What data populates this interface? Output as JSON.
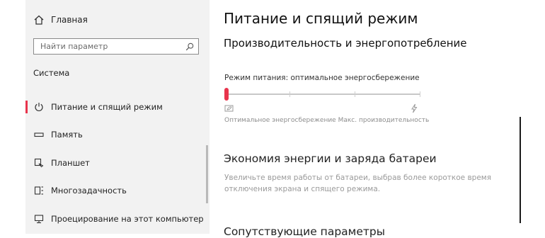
{
  "sidebar": {
    "home_label": "Главная",
    "search_placeholder": "Найти параметр",
    "section_title": "Система",
    "items": [
      {
        "label": "Питание и спящий режим",
        "icon": "power-icon",
        "active": true
      },
      {
        "label": "Память",
        "icon": "storage-icon",
        "active": false
      },
      {
        "label": "Планшет",
        "icon": "tablet-icon",
        "active": false
      },
      {
        "label": "Многозадачность",
        "icon": "multitasking-icon",
        "active": false
      },
      {
        "label": "Проецирование на этот компьютер",
        "icon": "projecting-icon",
        "active": false
      }
    ]
  },
  "main": {
    "title": "Питание и спящий режим",
    "subsection": "Производительность и энергопотребление",
    "power_mode_label": "Режим питания: оптимальное энергосбережение",
    "slider": {
      "value_fraction": 0.0,
      "positions": 4
    },
    "slider_caption": "Оптимальное энергосбережение Макс. производительность",
    "battery_saver_title": "Экономия энергии и заряда батареи",
    "battery_saver_desc": "Увеличьте время работы от батареи, выбрав более короткое время отключения экрана и спящего режима.",
    "related_title": "Сопутствующие параметры"
  },
  "colors": {
    "accent": "#e8344c",
    "sidebar_bg": "#f2f2f2"
  }
}
